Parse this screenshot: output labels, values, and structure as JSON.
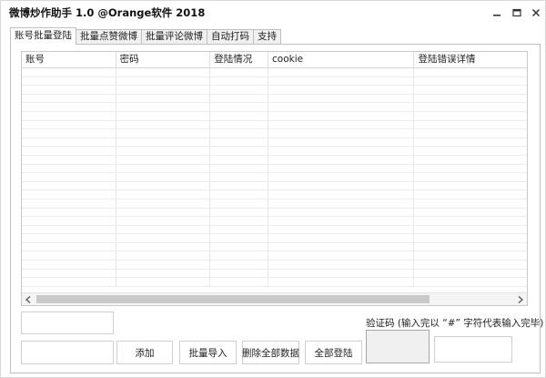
{
  "window": {
    "title": "微博炒作助手 1.0 @Orange软件 2018"
  },
  "tabs": [
    {
      "label": "账号批量登陆",
      "active": true
    },
    {
      "label": "批量点赞微博",
      "active": false
    },
    {
      "label": "批量评论微博",
      "active": false
    },
    {
      "label": "自动打码",
      "active": false
    },
    {
      "label": "支持",
      "active": false
    }
  ],
  "table": {
    "columns": [
      "账号",
      "密码",
      "登陆情况",
      "cookie",
      "登陆错误详情"
    ],
    "rows": []
  },
  "buttons": {
    "add": "添加",
    "import": "批量导入",
    "delete_all": "删除全部数据",
    "login_all": "全部登陆"
  },
  "captcha": {
    "label": "验证码 (输入完以 “#” 字符代表输入完毕)"
  },
  "icons": {
    "minimize": "minimize-icon",
    "maximize": "maximize-icon",
    "close": "close-icon",
    "scroll_left": "chevron-left-icon",
    "scroll_right": "chevron-right-icon"
  }
}
